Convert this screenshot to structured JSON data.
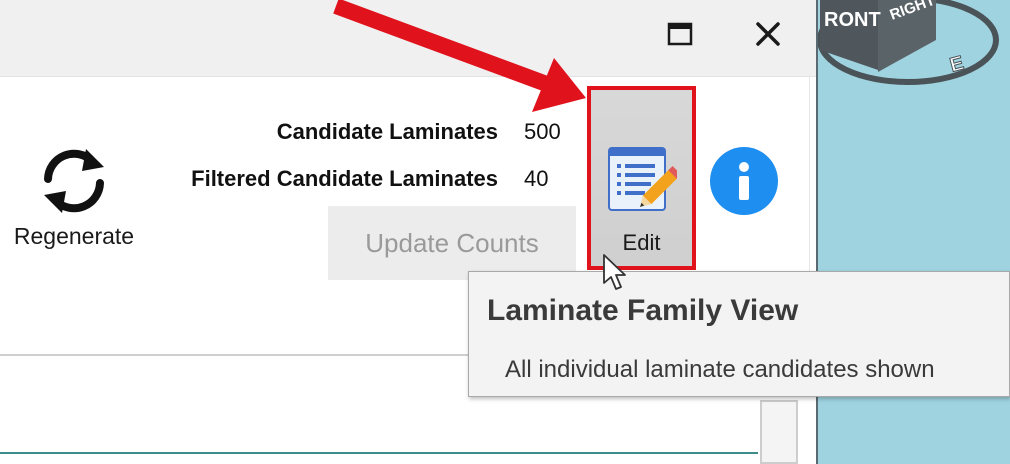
{
  "window": {
    "maximize_icon": "maximize-icon",
    "close_icon": "close-icon"
  },
  "viewport": {
    "front_label": "RONT",
    "right_label": "RIGHT",
    "compass_label": "E",
    "colors": {
      "background": "#9fd3e0",
      "cube": "#4a5358"
    }
  },
  "toolbar": {
    "regenerate": {
      "label": "Regenerate",
      "icon": "refresh-icon"
    },
    "stats": [
      {
        "label": "Candidate Laminates",
        "value": "500"
      },
      {
        "label": "Filtered Candidate Laminates",
        "value": "40"
      }
    ],
    "update_counts_label": "Update Counts",
    "edit": {
      "label": "Edit",
      "icon": "edit-list-icon"
    },
    "info_icon": "info-icon"
  },
  "tooltip": {
    "title": "Laminate Family View",
    "description": "All individual laminate candidates shown"
  },
  "annotation": {
    "arrow_color": "#e0121c",
    "highlight_color": "#e0121c"
  }
}
